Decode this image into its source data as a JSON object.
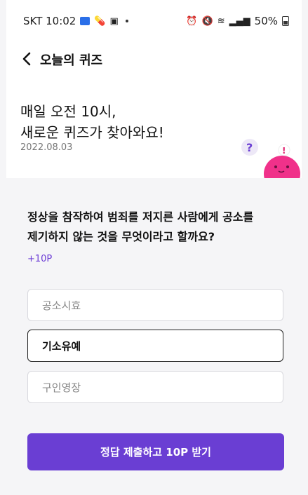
{
  "status_bar": {
    "carrier_time": "SKT 10:02",
    "battery": "50%"
  },
  "header": {
    "title": "오늘의 퀴즈"
  },
  "intro": {
    "line1": "매일 오전 10시,",
    "line2": "새로운 퀴즈가 찾아와요!",
    "date": "2022.08.03"
  },
  "quiz": {
    "question_line1": "정상을 참작하여 범죄를 저지른 사람에게 공소를",
    "question_line2": "제기하지 않는 것을 무엇이라고 할까요?",
    "points": "+10P",
    "options": [
      {
        "label": "공소시효",
        "selected": false
      },
      {
        "label": "기소유예",
        "selected": true
      },
      {
        "label": "구인영장",
        "selected": false
      }
    ],
    "submit_label": "정답 제출하고 10P 받기"
  },
  "colors": {
    "accent": "#6a3ed3",
    "mascot": "#f0318a"
  }
}
